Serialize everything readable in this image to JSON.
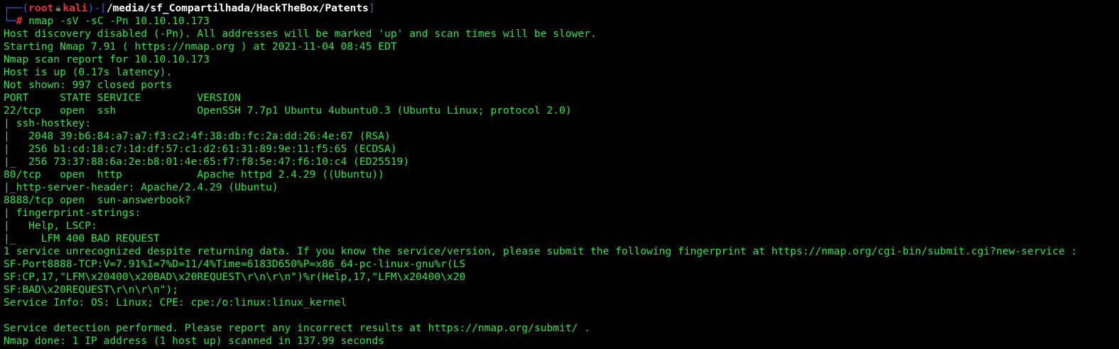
{
  "prompt": {
    "frame_open": "┌──(",
    "user": "root",
    "skull": "💀",
    "host": "kali",
    "frame_mid": ")-[",
    "path": "/media/sf_Compartilhada/HackTheBox/Patents",
    "frame_close": "]",
    "frame_corner": "└─",
    "hash": "#",
    "command": "nmap -sV -sC -Pn 10.10.10.173"
  },
  "output_lines": [
    "Host discovery disabled (-Pn). All addresses will be marked 'up' and scan times will be slower.",
    "Starting Nmap 7.91 ( https://nmap.org ) at 2021-11-04 08:45 EDT",
    "Nmap scan report for 10.10.10.173",
    "Host is up (0.17s latency).",
    "Not shown: 997 closed ports",
    "PORT     STATE SERVICE         VERSION",
    "22/tcp   open  ssh             OpenSSH 7.7p1 Ubuntu 4ubuntu0.3 (Ubuntu Linux; protocol 2.0)",
    "| ssh-hostkey: ",
    "|   2048 39:b6:84:a7:a7:f3:c2:4f:38:db:fc:2a:dd:26:4e:67 (RSA)",
    "|   256 b1:cd:18:c7:1d:df:57:c1:d2:61:31:89:9e:11:f5:65 (ECDSA)",
    "|_  256 73:37:88:6a:2e:b8:01:4e:65:f7:f8:5e:47:f6:10:c4 (ED25519)",
    "80/tcp   open  http            Apache httpd 2.4.29 ((Ubuntu))",
    "|_http-server-header: Apache/2.4.29 (Ubuntu)",
    "8888/tcp open  sun-answerbook?",
    "| fingerprint-strings: ",
    "|   Help, LSCP: ",
    "|_    LFM 400 BAD REQUEST",
    "1 service unrecognized despite returning data. If you know the service/version, please submit the following fingerprint at https://nmap.org/cgi-bin/submit.cgi?new-service :",
    "SF-Port8888-TCP:V=7.91%I=7%D=11/4%Time=6183D650%P=x86_64-pc-linux-gnu%r(LS",
    "SF:CP,17,\"LFM\\x20400\\x20BAD\\x20REQUEST\\r\\n\\r\\n\")%r(Help,17,\"LFM\\x20400\\x20",
    "SF:BAD\\x20REQUEST\\r\\n\\r\\n\");",
    "Service Info: OS: Linux; CPE: cpe:/o:linux:linux_kernel",
    "",
    "Service detection performed. Please report any incorrect results at https://nmap.org/submit/ .",
    "Nmap done: 1 IP address (1 host up) scanned in 137.99 seconds"
  ],
  "colors": {
    "background": "#000000",
    "output_green": "#31e34a",
    "frame_blue": "#2a62e6",
    "user_red": "#e5343a",
    "path_white": "#ffffff"
  }
}
